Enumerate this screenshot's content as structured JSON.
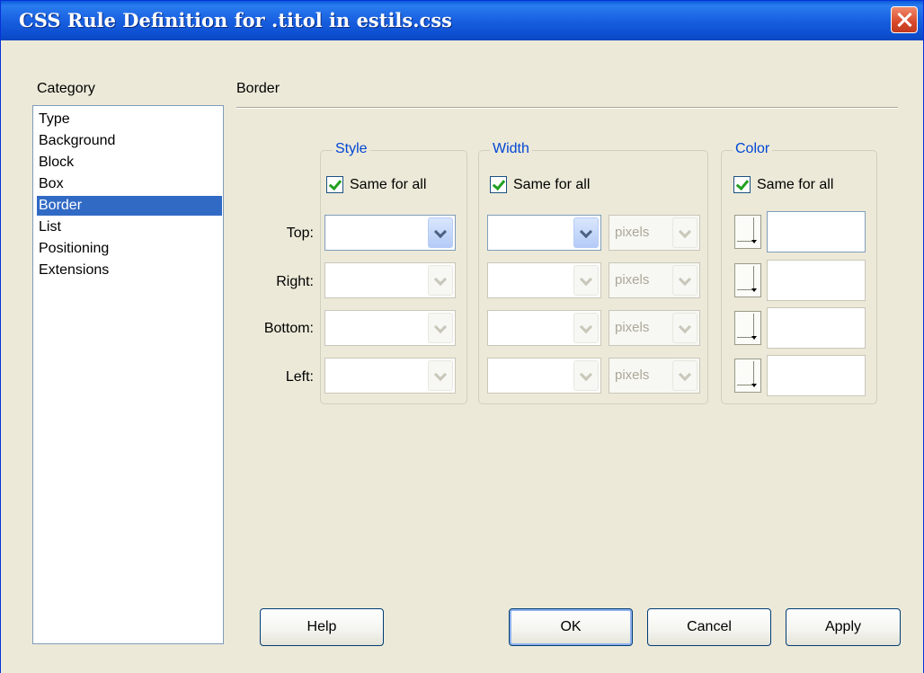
{
  "window": {
    "title": "CSS Rule Definition for .titol in estils.css"
  },
  "category": {
    "label": "Category",
    "items": [
      "Type",
      "Background",
      "Block",
      "Box",
      "Border",
      "List",
      "Positioning",
      "Extensions"
    ],
    "selected": "Border"
  },
  "section": {
    "title": "Border"
  },
  "groups": {
    "style": {
      "title": "Style",
      "same_for_all": "Same for all",
      "checked": true
    },
    "width": {
      "title": "Width",
      "same_for_all": "Same for all",
      "checked": true
    },
    "color": {
      "title": "Color",
      "same_for_all": "Same for all",
      "checked": true
    }
  },
  "rows": [
    "Top:",
    "Right:",
    "Bottom:",
    "Left:"
  ],
  "width_unit": "pixels",
  "buttons": {
    "help": "Help",
    "ok": "OK",
    "cancel": "Cancel",
    "apply": "Apply"
  },
  "colors": {
    "titlebar": "#0a5ad8",
    "selection": "#316ac5",
    "dialog_bg": "#ece9d8",
    "group_title": "#0046d5",
    "checkmark": "#21a121"
  }
}
